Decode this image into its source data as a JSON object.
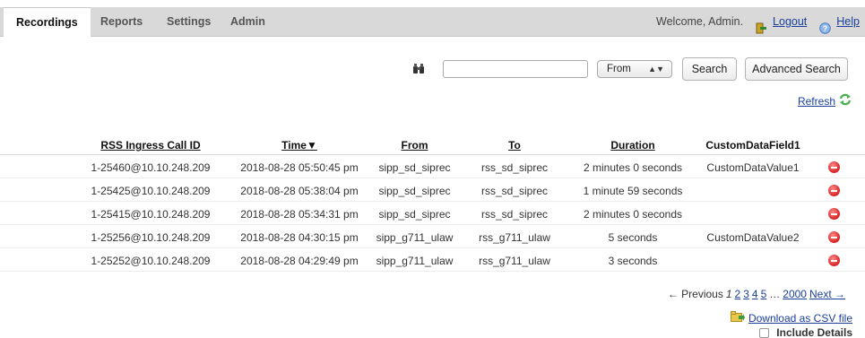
{
  "tabs": [
    {
      "label": "Recordings",
      "active": true
    },
    {
      "label": "Reports"
    },
    {
      "label": "Settings"
    },
    {
      "label": "Admin"
    }
  ],
  "header": {
    "welcome": "Welcome, Admin.",
    "logout": "Logout",
    "help": "Help"
  },
  "search": {
    "query": "",
    "field_selected": "From",
    "search_button": "Search",
    "advanced_button": "Advanced Search"
  },
  "refresh": "Refresh",
  "table": {
    "headers": {
      "call_id": "RSS Ingress Call ID",
      "time": "Time▼",
      "from": "From",
      "to": "To",
      "duration": "Duration",
      "custom": "CustomDataField1"
    },
    "rows": [
      {
        "call_id": "1-25460@10.10.248.209",
        "time": "2018-08-28 05:50:45 pm",
        "from": "sipp_sd_siprec",
        "to": "rss_sd_siprec",
        "duration": "2 minutes 0 seconds",
        "custom": "CustomDataValue1"
      },
      {
        "call_id": "1-25425@10.10.248.209",
        "time": "2018-08-28 05:38:04 pm",
        "from": "sipp_sd_siprec",
        "to": "rss_sd_siprec",
        "duration": "1 minute 59 seconds",
        "custom": ""
      },
      {
        "call_id": "1-25415@10.10.248.209",
        "time": "2018-08-28 05:34:31 pm",
        "from": "sipp_sd_siprec",
        "to": "rss_sd_siprec",
        "duration": "2 minutes 0 seconds",
        "custom": ""
      },
      {
        "call_id": "1-25256@10.10.248.209",
        "time": "2018-08-28 04:30:15 pm",
        "from": "sipp_g711_ulaw",
        "to": "rss_g711_ulaw",
        "duration": "5 seconds",
        "custom": "CustomDataValue2"
      },
      {
        "call_id": "1-25252@10.10.248.209",
        "time": "2018-08-28 04:29:49 pm",
        "from": "sipp_g711_ulaw",
        "to": "rss_g711_ulaw",
        "duration": "3 seconds",
        "custom": ""
      }
    ]
  },
  "pagination": {
    "previous": "← Previous",
    "current": "1",
    "pages": [
      "2",
      "3",
      "4",
      "5"
    ],
    "ellipsis": "…",
    "last": "2000",
    "next": "Next →"
  },
  "download": "Download as CSV file",
  "include_details": "Include Details",
  "icons": {
    "logout": "logout-icon",
    "help": "help-icon",
    "search": "binoculars-icon",
    "refresh": "refresh-icon",
    "delete": "delete-icon",
    "download": "download-icon"
  },
  "colors": {
    "link": "#1b3f9a",
    "topbar": "#d9d9d9",
    "delete": "#d92020",
    "refresh": "#4caf50"
  }
}
